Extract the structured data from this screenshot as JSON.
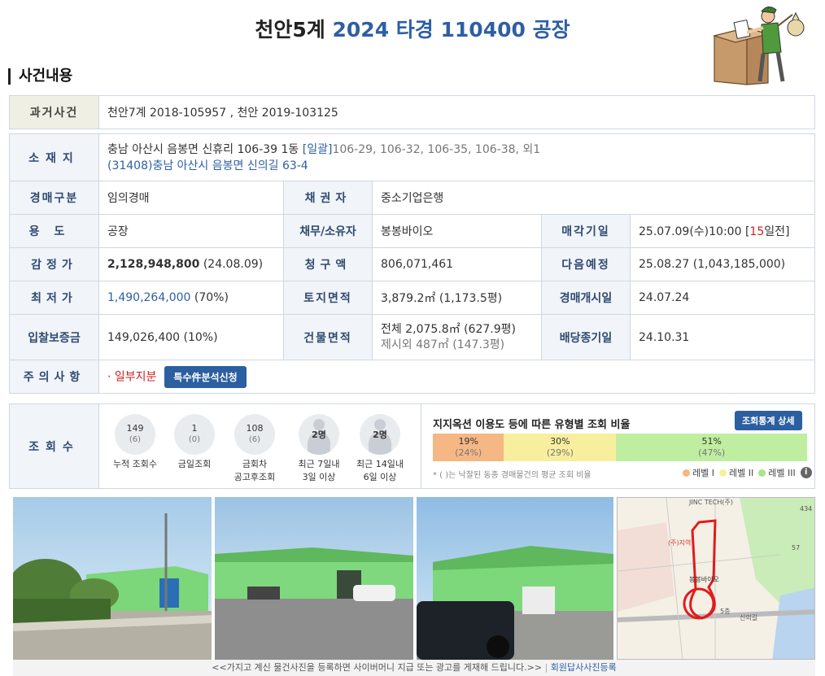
{
  "header": {
    "court": "천안5계",
    "case": "2024 타경 110400",
    "usage": "공장"
  },
  "section_title": "사건내용",
  "past_case": {
    "label": "과거사건",
    "value": "천안7계 2018-105957   , 천안 2019-103125"
  },
  "location": {
    "label": "소재지",
    "address": "충남 아산시 음봉면 신휴리 106-39 1동",
    "bulk_tag": "[일괄]",
    "bulk_list": "106-29, 106-32, 106-35, 106-38, 외1",
    "road_address": "(31408)충남 아산시  음봉면 신의길  63-4"
  },
  "rows": {
    "auction_type": {
      "label": "경매구분",
      "value": "임의경매"
    },
    "creditor": {
      "label": "채권자",
      "value": "중소기업은행"
    },
    "use": {
      "label": "용도",
      "value": "공장"
    },
    "debtor": {
      "label": "채무/소유자",
      "value": "봉봉바이오"
    },
    "sale_date": {
      "label": "매각기일",
      "value": "25.07.09(수)10:00 [",
      "dday": "15",
      "dday_suffix": "일전]"
    },
    "appraisal": {
      "label": "감정가",
      "value": "2,128,948,800",
      "date": " (24.08.09)"
    },
    "claim": {
      "label": "청구액",
      "value": "806,071,461"
    },
    "next_sched": {
      "label": "다음예정",
      "value": "25.08.27 (1,043,185,000)"
    },
    "min_price": {
      "label": "최저가",
      "value": "1,490,264,000",
      "pct": " (70%)"
    },
    "land_area": {
      "label": "토지면적",
      "value": "3,879.2㎡ (1,173.5평)"
    },
    "start_date": {
      "label": "경매개시일",
      "value": "24.07.24"
    },
    "deposit": {
      "label": "입찰보증금",
      "value": "149,026,400 (10%)"
    },
    "building_area": {
      "label": "건물면적",
      "value": "전체 2,075.8㎡ (627.9평)",
      "value2": "제시외 487㎡ (147.3평)"
    },
    "div_deadline": {
      "label": "배당종기일",
      "value": "24.10.31"
    },
    "notes": {
      "label": "주의사항",
      "value": "· 일부지분",
      "button": "특수件분석신청"
    }
  },
  "views": {
    "label": "조회수",
    "stats": [
      {
        "count": "149",
        "sub": "(6)",
        "label1": "누적 조회수",
        "label2": ""
      },
      {
        "count": "1",
        "sub": "(0)",
        "label1": "금일조회",
        "label2": ""
      },
      {
        "count": "108",
        "sub": "(6)",
        "label1": "금회차",
        "label2": "공고후조회"
      }
    ],
    "people": [
      {
        "count": "2명",
        "label1": "최근 7일내",
        "label2": "3일 이상"
      },
      {
        "count": "2명",
        "label1": "최근 14일내",
        "label2": "6일 이상"
      }
    ],
    "ratio_title": "지지옥션 이용도 등에 따른 유형별 조회 비율",
    "ratio_button": "조회통계 상세",
    "ratio": [
      {
        "pct": "19%",
        "avg": "(24%)",
        "color": "#f5b784"
      },
      {
        "pct": "30%",
        "avg": "(29%)",
        "color": "#f7ef9e"
      },
      {
        "pct": "51%",
        "avg": "(47%)",
        "color": "#bfeea0"
      }
    ],
    "ratio_values": [
      19,
      30,
      51
    ],
    "ratio_note": "* ( )는 낙찰된 동종 경매물건의 평균 조회 비율",
    "legend": [
      "레벨 I",
      "레벨 II",
      "레벨 III"
    ],
    "legend_colors": [
      "#f5b784",
      "#f7ef9e",
      "#a9e488"
    ]
  },
  "map_labels": [
    "JINC TECH(주)",
    "봉봉바이오",
    "(주)지역",
    "신의길",
    "434",
    "57",
    "5층"
  ],
  "footer": {
    "notice": "<<가지고 계신 물건사진을 등록하면 사이버머니 지급 또는 광고를 게재해 드립니다.>>",
    "link": "회원답사사진등록"
  }
}
